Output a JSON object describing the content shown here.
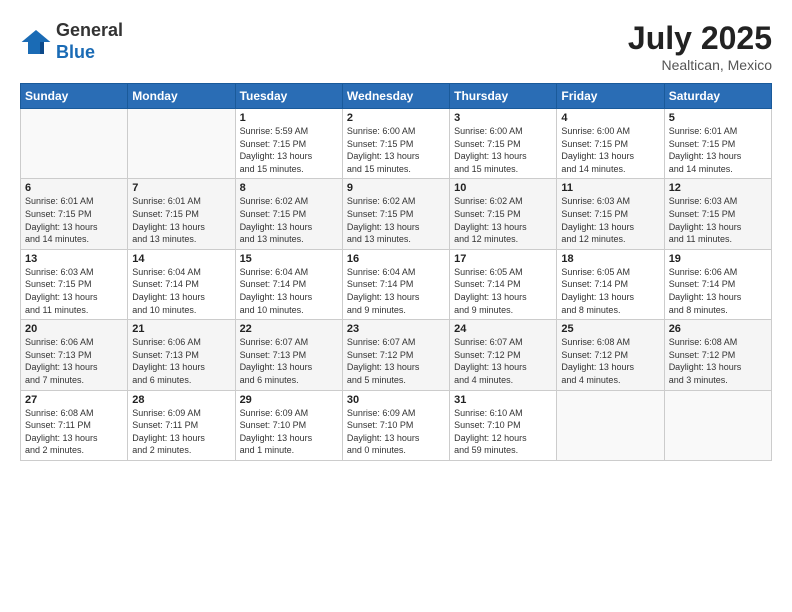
{
  "header": {
    "logo_general": "General",
    "logo_blue": "Blue",
    "month_year": "July 2025",
    "location": "Nealtican, Mexico"
  },
  "weekdays": [
    "Sunday",
    "Monday",
    "Tuesday",
    "Wednesday",
    "Thursday",
    "Friday",
    "Saturday"
  ],
  "weeks": [
    [
      {
        "day": "",
        "detail": ""
      },
      {
        "day": "",
        "detail": ""
      },
      {
        "day": "1",
        "detail": "Sunrise: 5:59 AM\nSunset: 7:15 PM\nDaylight: 13 hours\nand 15 minutes."
      },
      {
        "day": "2",
        "detail": "Sunrise: 6:00 AM\nSunset: 7:15 PM\nDaylight: 13 hours\nand 15 minutes."
      },
      {
        "day": "3",
        "detail": "Sunrise: 6:00 AM\nSunset: 7:15 PM\nDaylight: 13 hours\nand 15 minutes."
      },
      {
        "day": "4",
        "detail": "Sunrise: 6:00 AM\nSunset: 7:15 PM\nDaylight: 13 hours\nand 14 minutes."
      },
      {
        "day": "5",
        "detail": "Sunrise: 6:01 AM\nSunset: 7:15 PM\nDaylight: 13 hours\nand 14 minutes."
      }
    ],
    [
      {
        "day": "6",
        "detail": "Sunrise: 6:01 AM\nSunset: 7:15 PM\nDaylight: 13 hours\nand 14 minutes."
      },
      {
        "day": "7",
        "detail": "Sunrise: 6:01 AM\nSunset: 7:15 PM\nDaylight: 13 hours\nand 13 minutes."
      },
      {
        "day": "8",
        "detail": "Sunrise: 6:02 AM\nSunset: 7:15 PM\nDaylight: 13 hours\nand 13 minutes."
      },
      {
        "day": "9",
        "detail": "Sunrise: 6:02 AM\nSunset: 7:15 PM\nDaylight: 13 hours\nand 13 minutes."
      },
      {
        "day": "10",
        "detail": "Sunrise: 6:02 AM\nSunset: 7:15 PM\nDaylight: 13 hours\nand 12 minutes."
      },
      {
        "day": "11",
        "detail": "Sunrise: 6:03 AM\nSunset: 7:15 PM\nDaylight: 13 hours\nand 12 minutes."
      },
      {
        "day": "12",
        "detail": "Sunrise: 6:03 AM\nSunset: 7:15 PM\nDaylight: 13 hours\nand 11 minutes."
      }
    ],
    [
      {
        "day": "13",
        "detail": "Sunrise: 6:03 AM\nSunset: 7:15 PM\nDaylight: 13 hours\nand 11 minutes."
      },
      {
        "day": "14",
        "detail": "Sunrise: 6:04 AM\nSunset: 7:14 PM\nDaylight: 13 hours\nand 10 minutes."
      },
      {
        "day": "15",
        "detail": "Sunrise: 6:04 AM\nSunset: 7:14 PM\nDaylight: 13 hours\nand 10 minutes."
      },
      {
        "day": "16",
        "detail": "Sunrise: 6:04 AM\nSunset: 7:14 PM\nDaylight: 13 hours\nand 9 minutes."
      },
      {
        "day": "17",
        "detail": "Sunrise: 6:05 AM\nSunset: 7:14 PM\nDaylight: 13 hours\nand 9 minutes."
      },
      {
        "day": "18",
        "detail": "Sunrise: 6:05 AM\nSunset: 7:14 PM\nDaylight: 13 hours\nand 8 minutes."
      },
      {
        "day": "19",
        "detail": "Sunrise: 6:06 AM\nSunset: 7:14 PM\nDaylight: 13 hours\nand 8 minutes."
      }
    ],
    [
      {
        "day": "20",
        "detail": "Sunrise: 6:06 AM\nSunset: 7:13 PM\nDaylight: 13 hours\nand 7 minutes."
      },
      {
        "day": "21",
        "detail": "Sunrise: 6:06 AM\nSunset: 7:13 PM\nDaylight: 13 hours\nand 6 minutes."
      },
      {
        "day": "22",
        "detail": "Sunrise: 6:07 AM\nSunset: 7:13 PM\nDaylight: 13 hours\nand 6 minutes."
      },
      {
        "day": "23",
        "detail": "Sunrise: 6:07 AM\nSunset: 7:12 PM\nDaylight: 13 hours\nand 5 minutes."
      },
      {
        "day": "24",
        "detail": "Sunrise: 6:07 AM\nSunset: 7:12 PM\nDaylight: 13 hours\nand 4 minutes."
      },
      {
        "day": "25",
        "detail": "Sunrise: 6:08 AM\nSunset: 7:12 PM\nDaylight: 13 hours\nand 4 minutes."
      },
      {
        "day": "26",
        "detail": "Sunrise: 6:08 AM\nSunset: 7:12 PM\nDaylight: 13 hours\nand 3 minutes."
      }
    ],
    [
      {
        "day": "27",
        "detail": "Sunrise: 6:08 AM\nSunset: 7:11 PM\nDaylight: 13 hours\nand 2 minutes."
      },
      {
        "day": "28",
        "detail": "Sunrise: 6:09 AM\nSunset: 7:11 PM\nDaylight: 13 hours\nand 2 minutes."
      },
      {
        "day": "29",
        "detail": "Sunrise: 6:09 AM\nSunset: 7:10 PM\nDaylight: 13 hours\nand 1 minute."
      },
      {
        "day": "30",
        "detail": "Sunrise: 6:09 AM\nSunset: 7:10 PM\nDaylight: 13 hours\nand 0 minutes."
      },
      {
        "day": "31",
        "detail": "Sunrise: 6:10 AM\nSunset: 7:10 PM\nDaylight: 12 hours\nand 59 minutes."
      },
      {
        "day": "",
        "detail": ""
      },
      {
        "day": "",
        "detail": ""
      }
    ]
  ]
}
